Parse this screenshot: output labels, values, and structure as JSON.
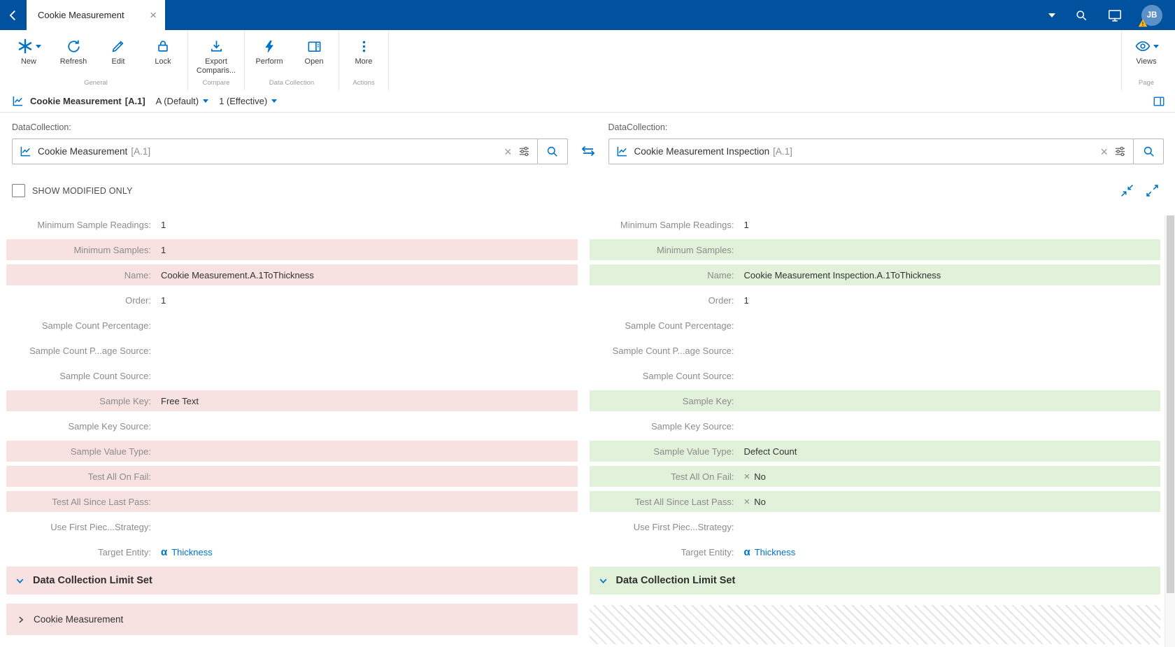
{
  "colors": {
    "topbar_blue": "#00519E",
    "accent_blue": "#0072C6",
    "modified_left_pink": "#F8E1E1",
    "modified_right_green": "#E1F1DA",
    "link_blue": "#0072C6",
    "warning_yellow": "#FCB814"
  },
  "icons": {
    "entity": "α",
    "cross": "×",
    "close": "×"
  },
  "topbar": {
    "tab_title": "Cookie Measurement",
    "avatar_initials": "JB"
  },
  "ribbon": {
    "new": "New",
    "refresh": "Refresh",
    "edit": "Edit",
    "lock": "Lock",
    "export_comparison": "Export Comparis...",
    "perform": "Perform",
    "open": "Open",
    "more": "More",
    "views": "Views",
    "group_general": "General",
    "group_compare": "Compare",
    "group_data_collection": "Data Collection",
    "group_actions": "Actions",
    "group_page": "Page"
  },
  "breadcrumb": {
    "title": "Cookie Measurement",
    "version_tag": "[A.1]",
    "revision": "A (Default)",
    "effective": "1 (Effective)"
  },
  "selectors": {
    "left_label": "DataCollection:",
    "left_value": "Cookie Measurement",
    "left_tag": "[A.1]",
    "right_label": "DataCollection:",
    "right_value": "Cookie Measurement Inspection",
    "right_tag": "[A.1]"
  },
  "filter": {
    "show_modified_only": "SHOW MODIFIED ONLY"
  },
  "left_panel": {
    "rows": [
      {
        "label": "Minimum Sample Readings:",
        "value": "1"
      },
      {
        "label": "Minimum Samples:",
        "value": "1"
      },
      {
        "label": "Name:",
        "value": "Cookie Measurement.A.1ToThickness"
      },
      {
        "label": "Order:",
        "value": "1"
      },
      {
        "label": "Sample Count Percentage:",
        "value": ""
      },
      {
        "label": "Sample Count P...age Source:",
        "value": ""
      },
      {
        "label": "Sample Count Source:",
        "value": ""
      },
      {
        "label": "Sample Key:",
        "value": "Free Text"
      },
      {
        "label": "Sample Key Source:",
        "value": ""
      },
      {
        "label": "Sample Value Type:",
        "value": ""
      },
      {
        "label": "Test All On Fail:",
        "value": ""
      },
      {
        "label": "Test All Since Last Pass:",
        "value": ""
      },
      {
        "label": "Use First Piec...Strategy:",
        "value": ""
      },
      {
        "label": "Target Entity:",
        "value": "Thickness"
      }
    ],
    "section_title": "Data Collection Limit Set",
    "collapsed_item": "Cookie Measurement"
  },
  "right_panel": {
    "rows": [
      {
        "label": "Minimum Sample Readings:",
        "value": "1"
      },
      {
        "label": "Minimum Samples:",
        "value": ""
      },
      {
        "label": "Name:",
        "value": "Cookie Measurement Inspection.A.1ToThickness"
      },
      {
        "label": "Order:",
        "value": "1"
      },
      {
        "label": "Sample Count Percentage:",
        "value": ""
      },
      {
        "label": "Sample Count P...age Source:",
        "value": ""
      },
      {
        "label": "Sample Count Source:",
        "value": ""
      },
      {
        "label": "Sample Key:",
        "value": ""
      },
      {
        "label": "Sample Key Source:",
        "value": ""
      },
      {
        "label": "Sample Value Type:",
        "value": "Defect Count"
      },
      {
        "label": "Test All On Fail:",
        "value": "No"
      },
      {
        "label": "Test All Since Last Pass:",
        "value": "No"
      },
      {
        "label": "Use First Piec...Strategy:",
        "value": ""
      },
      {
        "label": "Target Entity:",
        "value": "Thickness"
      }
    ],
    "section_title": "Data Collection Limit Set"
  }
}
